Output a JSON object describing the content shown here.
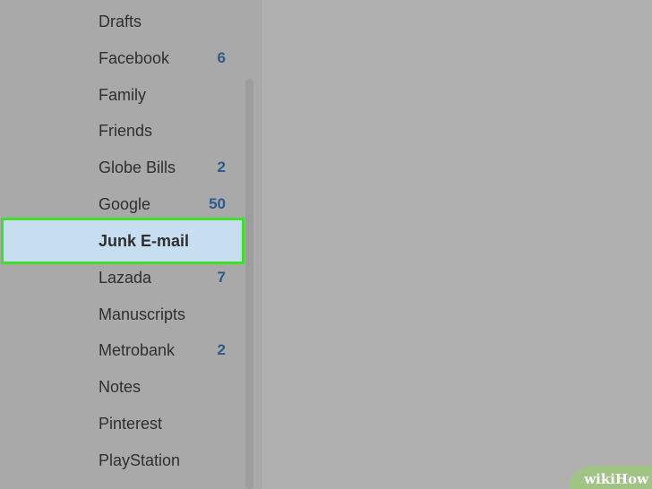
{
  "folders": [
    {
      "label": "Drafts",
      "count": ""
    },
    {
      "label": "Facebook",
      "count": "6"
    },
    {
      "label": "Family",
      "count": ""
    },
    {
      "label": "Friends",
      "count": ""
    },
    {
      "label": "Globe Bills",
      "count": "2"
    },
    {
      "label": "Google",
      "count": "50"
    },
    {
      "label": "Junk E-mail",
      "count": "",
      "selected": true
    },
    {
      "label": "Lazada",
      "count": "7"
    },
    {
      "label": "Manuscripts",
      "count": ""
    },
    {
      "label": "Metrobank",
      "count": "2"
    },
    {
      "label": "Notes",
      "count": ""
    },
    {
      "label": "Pinterest",
      "count": ""
    },
    {
      "label": "PlayStation",
      "count": ""
    }
  ],
  "watermark": {
    "part1": "wiki",
    "part2": "How"
  },
  "colors": {
    "highlight_border": "#3fe02a",
    "selected_bg": "#c7ddf0",
    "count_text": "#2d5a8c"
  }
}
